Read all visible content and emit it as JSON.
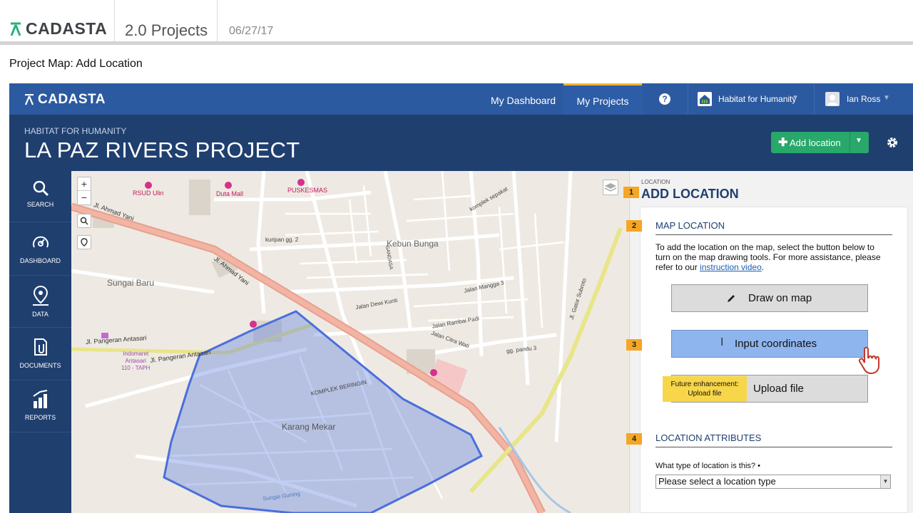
{
  "doc": {
    "brand": "CADASTA",
    "version": "2.0 Projects",
    "date": "06/27/17",
    "subtitle": "Project Map: Add Location"
  },
  "app": {
    "brand": "CADASTA",
    "nav": {
      "dashboard": "My Dashboard",
      "projects": "My Projects",
      "help_icon": "?",
      "organization": "Habitat for Humanity",
      "user": "Ian Ross"
    },
    "project": {
      "org_label": "HABITAT FOR HUMANITY",
      "title": "LA PAZ RIVERS PROJECT",
      "add_button": "Add location"
    },
    "sidebar": {
      "items": [
        {
          "label": "SEARCH",
          "icon": "search-icon"
        },
        {
          "label": "DASHBOARD",
          "icon": "dashboard-icon"
        },
        {
          "label": "DATA",
          "icon": "map-pin-icon"
        },
        {
          "label": "DOCUMENTS",
          "icon": "documents-icon"
        },
        {
          "label": "REPORTS",
          "icon": "reports-icon"
        }
      ]
    },
    "map": {
      "controls": {
        "zoom_in": "+",
        "zoom_out": "−"
      },
      "labels": {
        "rsud": "RSUD Ulin",
        "duta_mall": "Duta Mall",
        "puskesmas": "PUSKESMAS",
        "ahmad_yani_1": "Jl. Ahmad Yani",
        "ahmad_yani_2": "Jl. Ahmad Yani",
        "kebun_bunga": "Kebun Bunga",
        "sungai_baru": "Sungai Baru",
        "pangeran": "Jl. Pangeran Antasari",
        "pangeran2": "Jl. Pangeran Antasari",
        "indomaret": "Indomaret\nAntasari\n110 - TAPH",
        "karang_mekar": "Karang Mekar",
        "komplek": "KOMPLEK BERINGIN",
        "jalan_mangga": "Jalan Mangga 3",
        "jalan_dewi": "Jalan Dewi Kunti",
        "rambai": "Jalan Rambai Padi",
        "citra": "Jalan Citra Wati",
        "gator": "Jl. Gator Subroto",
        "pandu": "gg. pandu 3",
        "komplek_sepakat": "komplek sepakat",
        "kuripan": "kuripan gg. 2",
        "gandasa": "GANDASA",
        "sungai_guning": "Sungai Guning"
      }
    },
    "panel": {
      "small": "LOCATION",
      "title": "ADD LOCATION",
      "steps": [
        "1",
        "2",
        "3",
        "4"
      ],
      "map_location": "MAP LOCATION",
      "help_before": "To add the location on the map, select the button below to turn on the map drawing tools.  For more assistance, please refer to our ",
      "help_link": "instruction video",
      "help_after": ".",
      "draw_button": "Draw on map",
      "input_button": "Input coordinates",
      "upload_button": "Upload file",
      "future_note": "Future enhancement:\nUpload file",
      "attributes_title": "LOCATION ATTRIBUTES",
      "question": "What type of location is this? •",
      "select_value": "Please select a location type"
    },
    "colors": {
      "nav_blue": "#2c5aa0",
      "header_navy": "#1f3f6f",
      "add_green": "#28a86a",
      "step_orange": "#f5a623",
      "polygon": "#5b7fe0"
    }
  }
}
